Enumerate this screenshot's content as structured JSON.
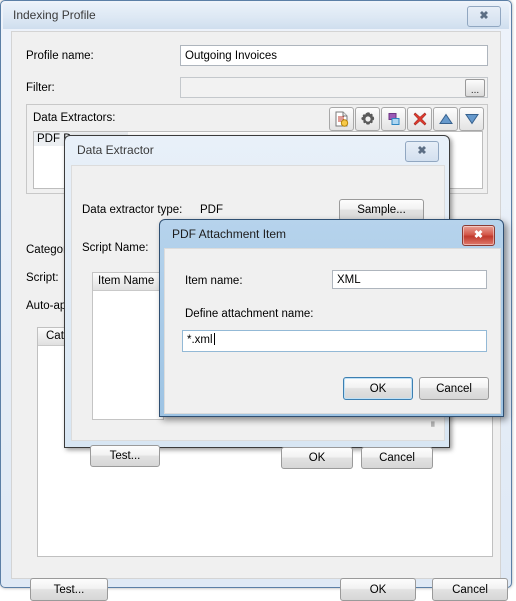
{
  "main_window": {
    "title": "Indexing Profile",
    "close_icon": "close-icon",
    "profile_name": {
      "label": "Profile name:",
      "value": "Outgoing Invoices"
    },
    "filter": {
      "label": "Filter:",
      "value": "",
      "browse_label": "..."
    },
    "data_extractors": {
      "label": "Data Extractors:",
      "toolbar": [
        {
          "name": "new-extractor-button",
          "icon": "new-document-icon"
        },
        {
          "name": "edit-extractor-button",
          "icon": "gear-icon"
        },
        {
          "name": "duplicate-extractor-button",
          "icon": "copy-icon"
        },
        {
          "name": "delete-extractor-button",
          "icon": "delete-x-icon"
        },
        {
          "name": "move-up-button",
          "icon": "triangle-up-icon"
        },
        {
          "name": "move-down-button",
          "icon": "triangle-down-icon"
        }
      ],
      "items": [
        "PDF Da"
      ]
    },
    "category_label": "Categor",
    "script_label": "Script:",
    "auto_apply_label": "Auto-ap",
    "category_list_header": "Cat",
    "buttons": {
      "test": "Test...",
      "ok": "OK",
      "cancel": "Cancel"
    }
  },
  "data_extractor_window": {
    "title": "Data Extractor",
    "close_icon": "close-icon",
    "type_label": "Data extractor type:",
    "type_value": "PDF",
    "sample_button": "Sample...",
    "script_name_label": "Script Name:",
    "item_list_header": "Item Name",
    "item_rows": [],
    "buttons": {
      "test": "Test...",
      "ok": "OK",
      "cancel": "Cancel"
    }
  },
  "pdf_attachment_window": {
    "title": "PDF Attachment Item",
    "close_icon": "close-icon",
    "item_name": {
      "label": "Item name:",
      "value": "XML"
    },
    "define_attachment": {
      "label": "Define attachment name:",
      "value": "*.xml"
    },
    "buttons": {
      "ok": "OK",
      "cancel": "Cancel"
    }
  },
  "colors": {
    "active_title": "#9dc3e3",
    "inactive_title": "#dde8f4",
    "close_active": "#c0392c",
    "dialog_face": "#f0f0f0",
    "default_button_border": "#3c7fb1"
  }
}
